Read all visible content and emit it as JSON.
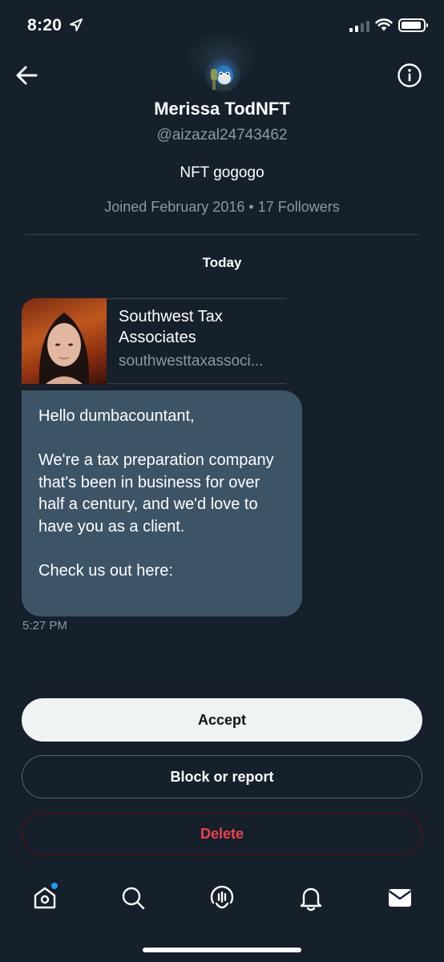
{
  "status_bar": {
    "time": "8:20"
  },
  "profile": {
    "display_name": "Merissa TodNFT",
    "handle": "@aizazal24743462",
    "bio": "NFT gogogo",
    "joined_text": "Joined February 2016",
    "separator": "•",
    "followers_text": "17 Followers"
  },
  "conversation": {
    "day_label": "Today",
    "link_card": {
      "title": "Southwest Tax Associates",
      "domain": "southwesttaxassoci..."
    },
    "message": {
      "text": "Hello dumbacountant,\n\n We're a tax preparation company that's been in business for over half a century, and we'd love to have you as a client.\n\n Check us out here:",
      "time": "5:27 PM"
    }
  },
  "actions": {
    "accept_label": "Accept",
    "block_label": "Block or report",
    "delete_label": "Delete"
  },
  "tab_bar": {
    "items": [
      {
        "icon": "home-icon",
        "has_badge": true
      },
      {
        "icon": "search-icon"
      },
      {
        "icon": "spaces-icon"
      },
      {
        "icon": "bell-icon"
      },
      {
        "icon": "mail-icon"
      }
    ]
  },
  "colors": {
    "background": "#15202b",
    "bubble": "#3d5466",
    "accent": "#1d9bf0",
    "danger": "#f4212e",
    "secondary_text": "#8899a6"
  }
}
